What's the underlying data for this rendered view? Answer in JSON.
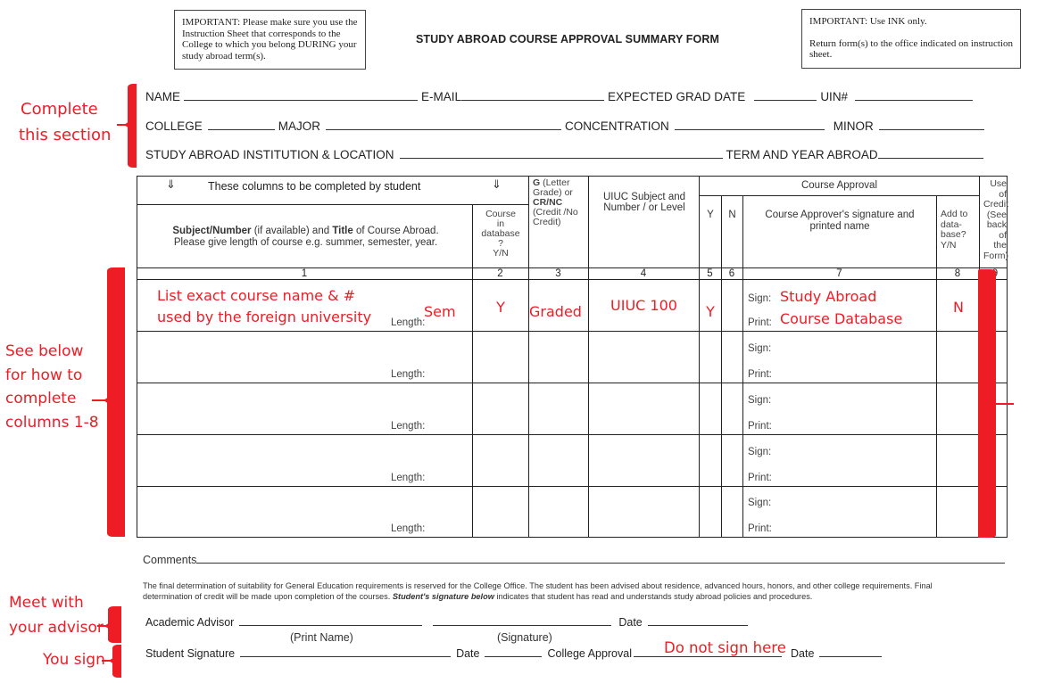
{
  "header": {
    "notice_left": "IMPORTANT: Please make sure you use the Instruction Sheet that corresponds to the College to which you belong DURING your study abroad term(s).",
    "title": "STUDY ABROAD COURSE APPROVAL SUMMARY FORM",
    "notice_right_line1": "IMPORTANT:  Use INK only.",
    "notice_right_line2": "Return form(s) to the office indicated on instruction sheet."
  },
  "student_fields": {
    "name": "NAME",
    "email": "E-MAIL",
    "expected_grad_date": "EXPECTED GRAD DATE",
    "uin": "UIN#",
    "college": "COLLEGE",
    "major": "MAJOR",
    "concentration": "CONCENTRATION",
    "minor": "MINOR",
    "institution_location": "STUDY ABROAD INSTITUTION & LOCATION",
    "term_year": "TERM AND YEAR ABROAD"
  },
  "table": {
    "student_banner": "These columns to be completed by student",
    "arrow_glyph": "⇓",
    "col1_bold1": "Subject/Number",
    "col1_text1": " (if available) and ",
    "col1_bold2": "Title",
    "col1_text2": " of Course Abroad.",
    "col1_line2": "Please give length of course e.g. summer, semester, year.",
    "col2_header": [
      "Course",
      "in",
      "database",
      "?",
      "Y/N"
    ],
    "col3_bold1": "G",
    "col3_text1": " (Letter Grade) or",
    "col3_bold2": "CR/NC",
    "col3_text2": "(Credit /No Credit)",
    "col4_header": "UIUC Subject and Number / or Level",
    "course_approval": "Course Approval",
    "col5_header": "Y",
    "col6_header": "N",
    "col7_header": "Course Approver's signature and printed name",
    "col8_header": "Add to data-base? Y/N",
    "col9_header": "Use of Credit (See back of the Form)",
    "column_numbers": [
      "1",
      "2",
      "3",
      "4",
      "5",
      "6",
      "7",
      "8",
      "9"
    ],
    "length_label": "Length:",
    "sign_label": "Sign:",
    "print_label": "Print:",
    "row_count": 5,
    "example_row": {
      "course_name_line1": "List exact course name & #",
      "course_name_line2": "used by the foreign university",
      "length": "Sem",
      "in_database": "Y",
      "grade": "Graded",
      "uiuc_subject": "UIUC 100",
      "approved_y": "Y",
      "sign": "Study Abroad",
      "print": "Course Database",
      "add_to_db": "N"
    }
  },
  "footer": {
    "comments": "Comments",
    "disclaimer_line1": "The final determination of suitability for General Education requirements is reserved for the College Office. The student has been advised about residence, advanced hours, honors, and other college requirements. Final",
    "disclaimer_line2_a": "determination of credit will be made upon completion of the courses.  ",
    "disclaimer_line2_bold": "Student's signature below",
    "disclaimer_line2_b": " indicates that student has read and understands study abroad policies and procedures.",
    "academic_advisor": "Academic Advisor",
    "date": "Date",
    "print_name": "(Print Name)",
    "signature": "(Signature)",
    "student_signature": "Student Signature",
    "college_approval": "College Approval"
  },
  "annotations": {
    "complete_section": [
      "Complete",
      "this section"
    ],
    "see_below": [
      "See below",
      "for how to",
      "complete",
      "columns 1-8"
    ],
    "meet_advisor": [
      "Meet with",
      "your advisor"
    ],
    "you_sign": "You sign",
    "do_not_sign": "Do not sign here",
    "annotation_color": "#ee1c25"
  }
}
